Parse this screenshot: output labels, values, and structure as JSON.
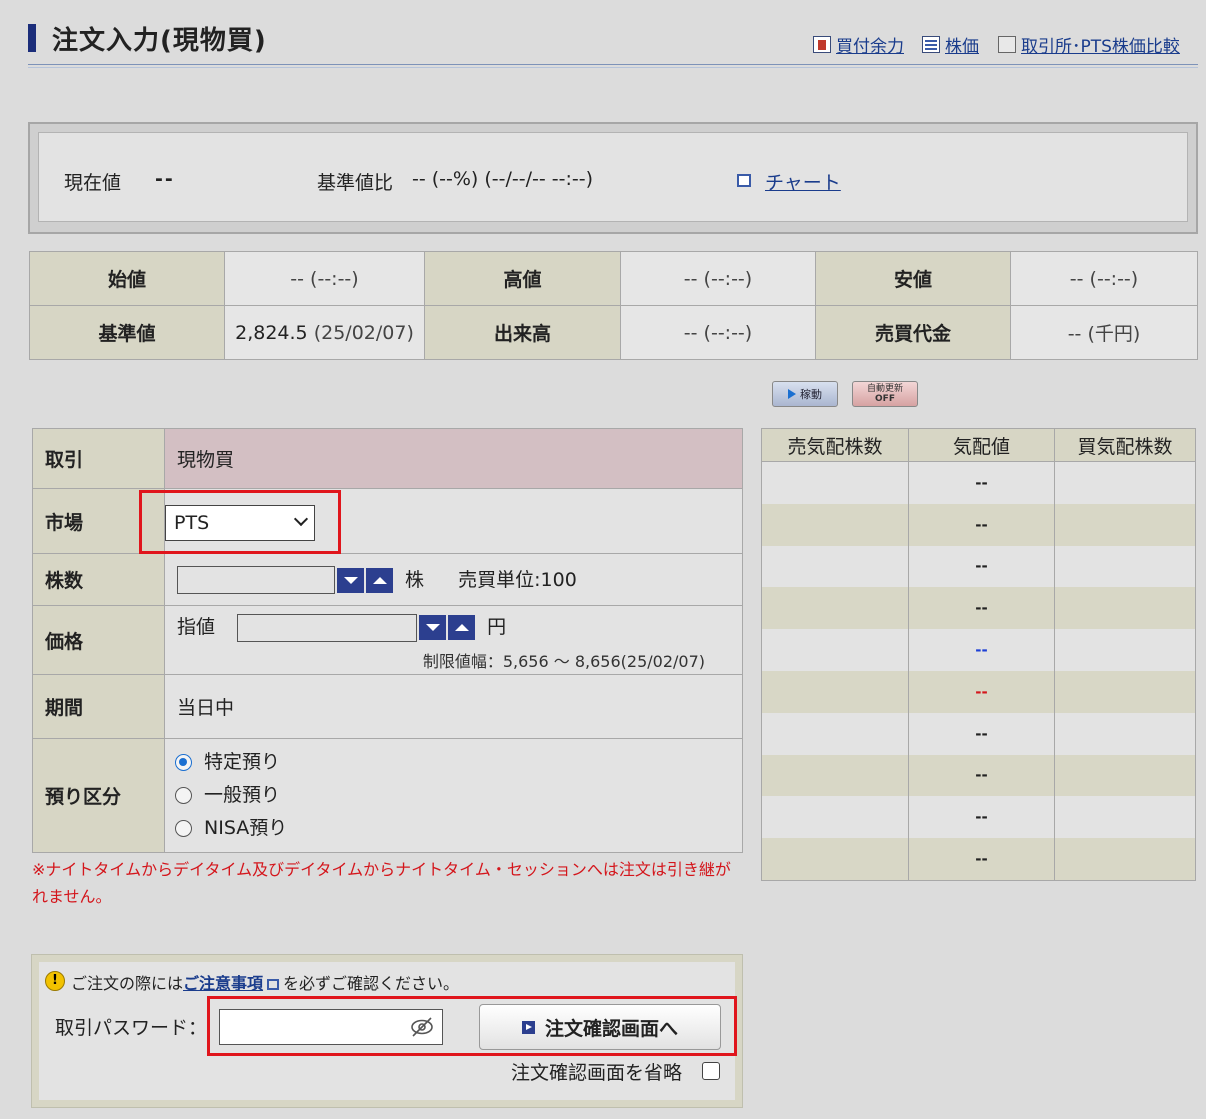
{
  "header": {
    "title": "注文入力(現物買)",
    "links": [
      "買付余力",
      "株価",
      "取引所･PTS株価比較"
    ]
  },
  "current": {
    "label": "現在値",
    "value": "--",
    "change_label": "基準値比",
    "change_value": "-- (--%) (--/--/-- --:--)",
    "chart_link": "チャート"
  },
  "stats": {
    "open_label": "始値",
    "open_value": "-- (--:--)",
    "high_label": "高値",
    "high_value": "-- (--:--)",
    "low_label": "安値",
    "low_value": "-- (--:--)",
    "base_label": "基準値",
    "base_value": "2,824.5",
    "base_date": "(25/02/07)",
    "volume_label": "出来高",
    "volume_value": "-- (--:--)",
    "turnover_label": "売買代金",
    "turnover_value": "-- (千円)"
  },
  "buttons": {
    "running": "稼動",
    "auto_update_line1": "自動更新",
    "auto_update_line2": "OFF"
  },
  "form": {
    "trade_label": "取引",
    "trade_value": "現物買",
    "market_label": "市場",
    "market_selected": "PTS",
    "shares_label": "株数",
    "shares_unit": "株",
    "unit_info": "売買単位:100",
    "price_label": "価格",
    "price_type": "指値",
    "price_unit": "円",
    "price_limit": "制限値幅：5,656 〜 8,656(25/02/07)",
    "period_label": "期間",
    "period_value": "当日中",
    "account_label": "預り区分",
    "account_options": [
      "特定預り",
      "一般預り",
      "NISA預り"
    ],
    "account_selected": "特定預り"
  },
  "notice": "※ナイトタイムからデイタイム及びデイタイムからナイトタイム・セッションへは注文は引き継がれません。",
  "book": {
    "headers": [
      "売気配株数",
      "気配値",
      "買気配株数"
    ],
    "prices": [
      "--",
      "--",
      "--",
      "--",
      "--",
      "--",
      "--",
      "--",
      "--",
      "--"
    ],
    "price_colors": [
      "#222222",
      "#222222",
      "#222222",
      "#222222",
      "#1d3fd6",
      "#d4161c",
      "#222222",
      "#222222",
      "#222222",
      "#222222"
    ]
  },
  "password": {
    "warn_prefix": "ご注文の際には",
    "warn_link": "ご注意事項",
    "warn_suffix": "を必ずご確認ください。",
    "label": "取引パスワード：",
    "confirm_button": "注文確認画面へ",
    "skip_label": "注文確認画面を省略"
  }
}
